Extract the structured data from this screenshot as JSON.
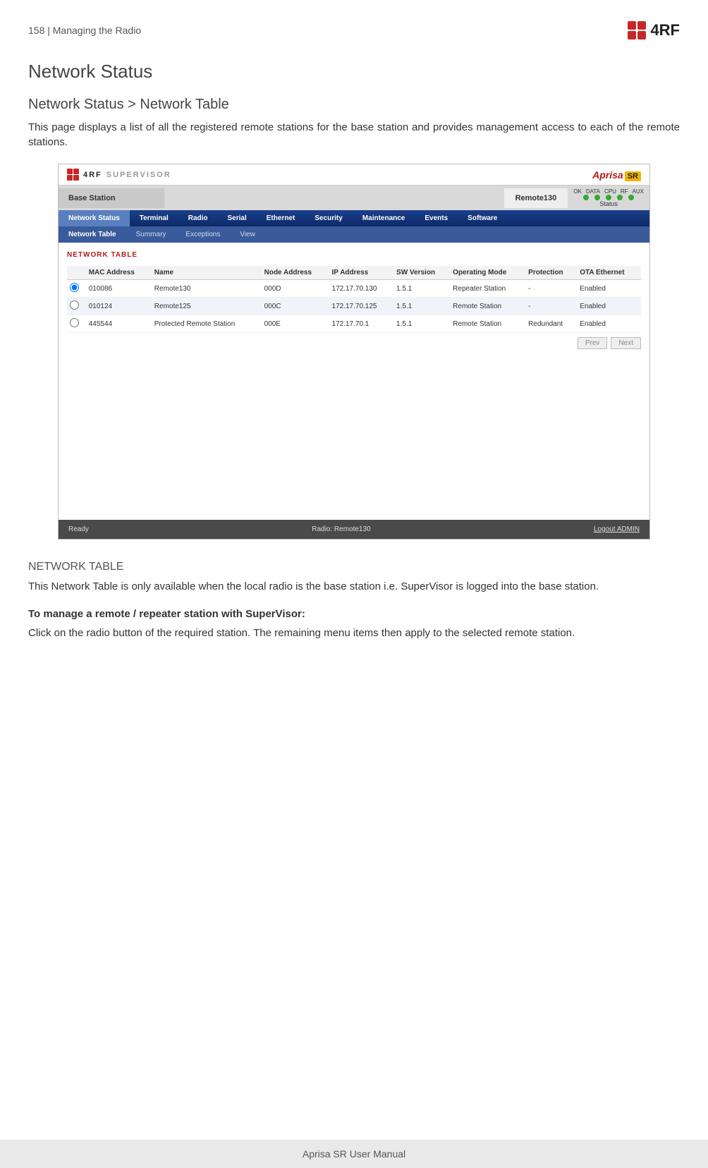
{
  "header": {
    "page_num_section": "158  |  Managing the Radio",
    "logo_text": "4RF"
  },
  "h1": "Network Status",
  "breadcrumb": "Network Status > Network Table",
  "intro": "This page displays a list of all the registered remote stations for the base station and provides management access to each of the remote stations.",
  "section_heading": "NETWORK TABLE",
  "section_text": "This Network Table is only available when the local radio is the base station i.e. SuperVisor is logged into the base station.",
  "bold_heading": "To manage a remote / repeater station with SuperVisor:",
  "bold_text": "Click on the radio button of the required station. The remaining menu items then apply to the selected remote station.",
  "footer": "Aprisa SR User Manual",
  "screenshot": {
    "supervisor_label": "SUPERVISOR",
    "aprisa_label": "Aprisa",
    "aprisa_sr": "SR",
    "base_station": "Base Station",
    "remote": "Remote130",
    "led_labels": [
      "OK",
      "DATA",
      "CPU",
      "RF",
      "AUX"
    ],
    "status_label": "Status",
    "menubar": [
      "Network Status",
      "Terminal",
      "Radio",
      "Serial",
      "Ethernet",
      "Security",
      "Maintenance",
      "Events",
      "Software"
    ],
    "submenu": [
      "Network Table",
      "Summary",
      "Exceptions",
      "View"
    ],
    "panel_title": "NETWORK TABLE",
    "columns": [
      "",
      "MAC Address",
      "Name",
      "Node Address",
      "IP Address",
      "SW Version",
      "Operating Mode",
      "Protection",
      "OTA Ethernet"
    ],
    "rows": [
      {
        "selected": true,
        "mac": "010086",
        "name": "Remote130",
        "node": "000D",
        "ip": "172.17.70.130",
        "ver": "1.5.1",
        "mode": "Repeater Station",
        "prot": "-",
        "ota": "Enabled"
      },
      {
        "selected": false,
        "mac": "010124",
        "name": "Remote125",
        "node": "000C",
        "ip": "172.17.70.125",
        "ver": "1.5.1",
        "mode": "Remote Station",
        "prot": "-",
        "ota": "Enabled"
      },
      {
        "selected": false,
        "mac": "445544",
        "name": "Protected Remote Station",
        "node": "000E",
        "ip": "172.17.70.1",
        "ver": "1.5.1",
        "mode": "Remote Station",
        "prot": "Redundant",
        "ota": "Enabled"
      }
    ],
    "prev": "Prev",
    "next": "Next",
    "footer_ready": "Ready",
    "footer_radio": "Radio: Remote130",
    "footer_logout": "Logout ADMIN"
  }
}
